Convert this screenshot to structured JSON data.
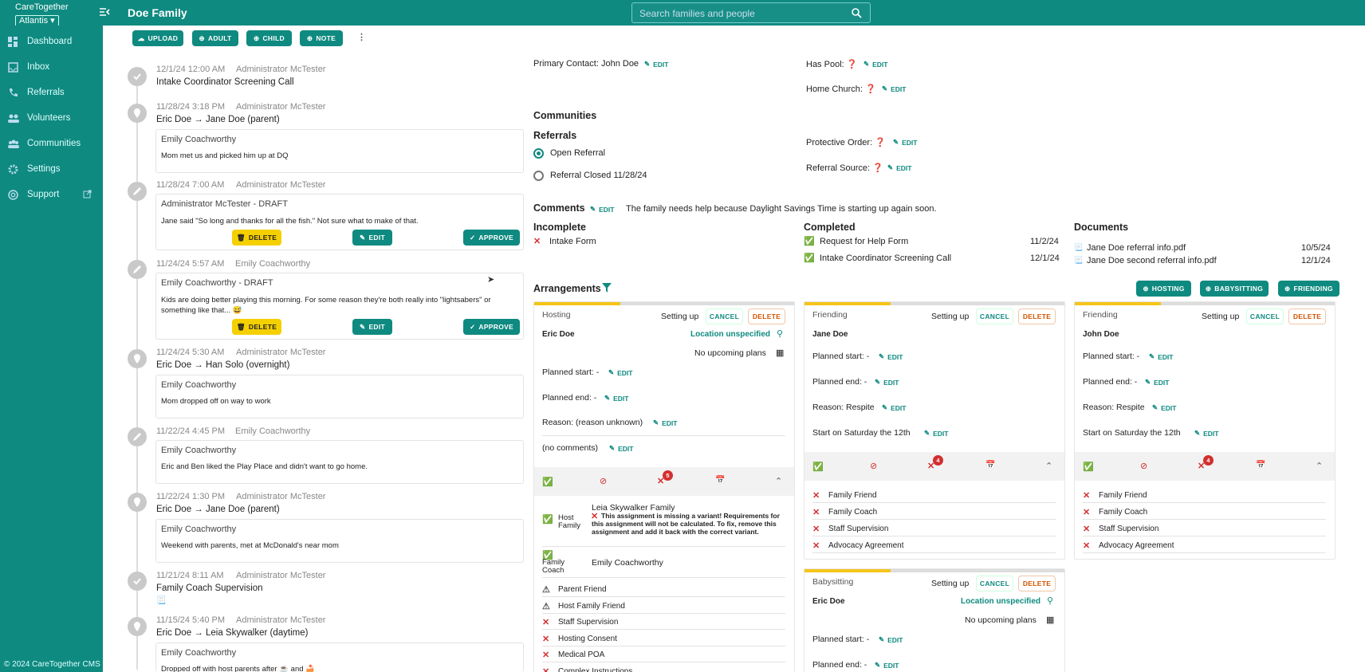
{
  "app": {
    "name": "CareTogether",
    "org": "Atlantis",
    "page_title": "Doe Family",
    "copyright": "© 2024  CareTogether CMS"
  },
  "search": {
    "placeholder": "Search families and people"
  },
  "nav": [
    "Dashboard",
    "Inbox",
    "Referrals",
    "Volunteers",
    "Communities",
    "Settings",
    "Support"
  ],
  "toolbar": {
    "upload": "UPLOAD",
    "adult": "ADULT",
    "child": "CHILD",
    "note": "NOTE"
  },
  "timeline": [
    {
      "date": "12/1/24 12:00 AM",
      "user": "Administrator McTester",
      "title": "Intake Coordinator Screening Call"
    },
    {
      "date": "11/28/24 3:18 PM",
      "user": "Administrator McTester",
      "title": "Eric Doe → Jane Doe (parent)",
      "note_author": "Emily Coachworthy",
      "note_text": "Mom met us and picked him up at DQ"
    },
    {
      "date": "11/28/24 7:00 AM",
      "user": "Administrator McTester",
      "note_author": "Administrator McTester - DRAFT",
      "note_text": "Jane said \"So long and thanks for all the fish.\" Not sure what to make of that."
    },
    {
      "date": "11/24/24 5:57 AM",
      "user": "Emily Coachworthy",
      "note_author": "Emily Coachworthy - DRAFT",
      "note_text": "Kids are doing better playing this morning. For some reason they're both really into \"lightsabers\" or something like that... 😅"
    },
    {
      "date": "11/24/24 5:30 AM",
      "user": "Administrator McTester",
      "title": "Eric Doe → Han Solo (overnight)",
      "note_author": "Emily Coachworthy",
      "note_text": "Mom dropped off on way to work"
    },
    {
      "date": "11/22/24 4:45 PM",
      "user": "Emily Coachworthy",
      "note_author": "Emily Coachworthy",
      "note_text": "Eric and Ben liked the Play Place and didn't want to go home."
    },
    {
      "date": "11/22/24 1:30 PM",
      "user": "Administrator McTester",
      "title": "Eric Doe → Jane Doe (parent)",
      "note_author": "Emily Coachworthy",
      "note_text": "Weekend with parents, met at McDonald's near mom"
    },
    {
      "date": "11/21/24 8:11 AM",
      "user": "Administrator McTester",
      "title": "Family Coach Supervision",
      "extra": "📃"
    },
    {
      "date": "11/15/24 5:40 PM",
      "user": "Administrator McTester",
      "title": "Eric Doe → Leia Skywalker (daytime)",
      "note_author": "Emily Coachworthy",
      "note_text": "Dropped off with host parents after ☕ and 🍰"
    }
  ],
  "note_buttons": {
    "delete": "DELETE",
    "edit": "EDIT",
    "approve": "APPROVE"
  },
  "family": {
    "primary_contact": "Primary Contact: John Doe",
    "has_pool": "Has Pool:",
    "home_church": "Home Church:",
    "protective_order": "Protective Order:",
    "referral_source": "Referral Source:",
    "q": "❓",
    "edit": "EDIT",
    "communities": "Communities",
    "referrals": "Referrals",
    "open_referral": "Open Referral",
    "closed_referral": "Referral Closed 11/28/24",
    "comments_label": "Comments",
    "comments_text": "The family needs help because Daylight Savings Time is starting up again soon.",
    "incomplete_label": "Incomplete",
    "incomplete": [
      "Intake Form"
    ],
    "completed_label": "Completed",
    "completed": [
      {
        "name": "Request for Help Form",
        "date": "11/2/24"
      },
      {
        "name": "Intake Coordinator Screening Call",
        "date": "12/1/24"
      }
    ],
    "documents_label": "Documents",
    "documents": [
      {
        "name": "Jane Doe referral info.pdf",
        "date": "10/5/24"
      },
      {
        "name": "Jane Doe second referral info.pdf",
        "date": "12/1/24"
      }
    ]
  },
  "arrangements": {
    "title": "Arrangements",
    "add_hosting": "HOSTING",
    "add_babysitting": "BABYSITTING",
    "add_friending": "FRIENDING",
    "status": "Setting up",
    "cancel": "CANCEL",
    "delete": "DELETE",
    "edit": "EDIT",
    "hosting": {
      "type": "Hosting",
      "person": "Eric Doe",
      "location": "Location unspecified",
      "plans": "No upcoming plans",
      "planned_start": "Planned start: -",
      "planned_end": "Planned end: -",
      "reason": "Reason: (reason unknown)",
      "comments": "(no comments)",
      "badge": "5",
      "host_family_label": "Host Family",
      "host_family_name": "Leia Skywalker Family",
      "warning": "This assignment is missing a variant! Requirements for this assignment will not be calculated. To fix, remove this assignment and add it back with the correct variant.",
      "coach_label": "Family Coach",
      "coach_name": "Emily Coachworthy",
      "reqs": [
        {
          "i": "⚠",
          "t": "Parent Friend"
        },
        {
          "i": "⚠",
          "t": "Host Family Friend"
        },
        {
          "i": "✕",
          "t": "Staff Supervision"
        },
        {
          "i": "✕",
          "t": "Hosting Consent"
        },
        {
          "i": "✕",
          "t": "Medical POA"
        },
        {
          "i": "✕",
          "t": "Complex Instructions"
        }
      ]
    },
    "friending1": {
      "type": "Friending",
      "person": "Jane Doe",
      "planned_start": "Planned start: -",
      "planned_end": "Planned end: -",
      "reason": "Reason: Respite",
      "start_on": "Start on Saturday the 12th",
      "badge": "4",
      "reqs": [
        "Family Friend",
        "Family Coach",
        "Staff Supervision",
        "Advocacy Agreement"
      ]
    },
    "friending2": {
      "type": "Friending",
      "person": "John Doe",
      "planned_start": "Planned start: -",
      "planned_end": "Planned end: -",
      "reason": "Reason: Respite",
      "start_on": "Start on Saturday the 12th",
      "badge": "4",
      "reqs": [
        "Family Friend",
        "Family Coach",
        "Staff Supervision",
        "Advocacy Agreement"
      ]
    },
    "babysitting": {
      "type": "Babysitting",
      "person": "Eric Doe",
      "location": "Location unspecified",
      "plans": "No upcoming plans",
      "planned_start": "Planned start: -",
      "planned_end": "Planned end: -"
    }
  },
  "colors": {
    "brand": "#0f8a80",
    "accent": "#f5c518",
    "danger": "#d32f2f"
  }
}
